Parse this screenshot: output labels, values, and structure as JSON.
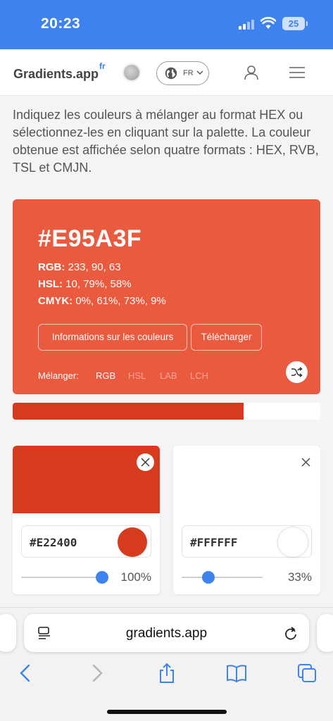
{
  "status_bar": {
    "time": "20:23",
    "battery": "25"
  },
  "header": {
    "logo": "Gradients.app",
    "logo_sup": "fr",
    "language": "FR"
  },
  "intro_text": "Indiquez les couleurs à mélanger au format HEX ou sélectionnez-les en cliquant sur la palette. La couleur obtenue est affichée selon quatre formats : HEX, RVB, TSL et CMJN.",
  "result": {
    "hex": "#E95A3F",
    "color": "#e95a3f",
    "rgb_label": "RGB:",
    "rgb_value": "233, 90, 63",
    "hsl_label": "HSL:",
    "hsl_value": "10, 79%, 58%",
    "cmyk_label": "CMYK:",
    "cmyk_value": "0%, 61%, 73%, 9%",
    "info_button": "Informations sur les couleurs",
    "download_button": "Télécharger",
    "mix_label": "Mélanger:",
    "mix_options": [
      "RGB",
      "HSL",
      "LAB",
      "LCH"
    ],
    "mix_active": "RGB"
  },
  "mix_bar": {
    "fill_fraction": 0.75,
    "color": "#d63b1e"
  },
  "colors": [
    {
      "hex": "#E22400",
      "swatch": "#d63b1e",
      "percent": "100%",
      "slider_fraction": 1.0
    },
    {
      "hex": "#FFFFFF",
      "swatch": "#ffffff",
      "percent": "33%",
      "slider_fraction": 0.33
    }
  ],
  "browser": {
    "url": "gradients.app"
  },
  "accent_color": "#3d82ee"
}
